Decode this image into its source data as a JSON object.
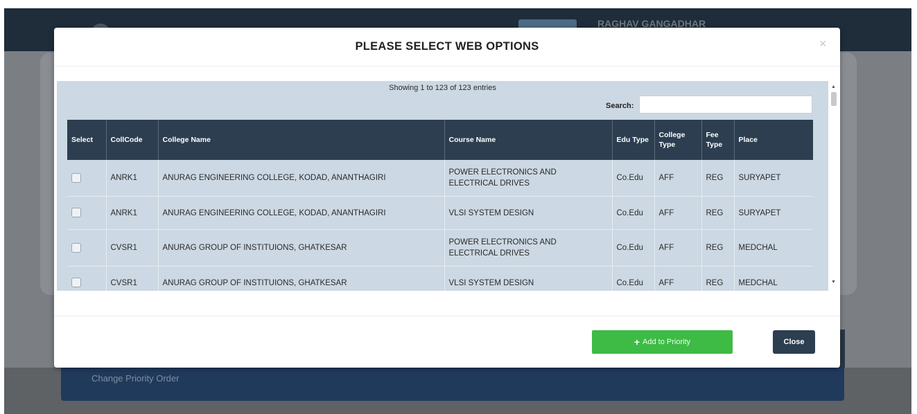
{
  "background": {
    "username": "RAGHAV GANGADHAR",
    "panel_label": "Change Priority Order"
  },
  "modal": {
    "title": "PLEASE SELECT WEB OPTIONS",
    "close_icon": "×",
    "info": "Showing 1 to 123 of 123 entries",
    "search_label": "Search:",
    "search_value": "",
    "columns": [
      "Select",
      "CollCode",
      "College Name",
      "Course Name",
      "Edu Type",
      "College Type",
      "Fee Type",
      "Place"
    ],
    "rows": [
      {
        "code": "ANRK1",
        "college": "ANURAG ENGINEERING COLLEGE, KODAD, ANANTHAGIRI",
        "course": "POWER ELECTRONICS AND ELECTRICAL DRIVES",
        "edu": "Co.Edu",
        "ctype": "AFF",
        "fee": "REG",
        "place": "SURYAPET",
        "checked": false
      },
      {
        "code": "ANRK1",
        "college": "ANURAG ENGINEERING COLLEGE, KODAD, ANANTHAGIRI",
        "course": "VLSI SYSTEM DESIGN",
        "edu": "Co.Edu",
        "ctype": "AFF",
        "fee": "REG",
        "place": "SURYAPET",
        "checked": false
      },
      {
        "code": "CVSR1",
        "college": "ANURAG GROUP OF INSTITUIONS, GHATKESAR",
        "course": "POWER ELECTRONICS AND ELECTRICAL DRIVES",
        "edu": "Co.Edu",
        "ctype": "AFF",
        "fee": "REG",
        "place": "MEDCHAL",
        "checked": false
      },
      {
        "code": "CVSR1",
        "college": "ANURAG GROUP OF INSTITUIONS, GHATKESAR",
        "course": "VLSI SYSTEM DESIGN",
        "edu": "Co.Edu",
        "ctype": "AFF",
        "fee": "REG",
        "place": "MEDCHAL",
        "checked": false
      }
    ],
    "add_button": "Add to Priority",
    "close_button": "Close"
  },
  "icons": {
    "add": "plus-icon",
    "close": "close-icon",
    "scroll_up": "scroll-up-arrow-icon",
    "scroll_down": "scroll-down-arrow-icon"
  },
  "colors": {
    "table_header": "#2c3e50",
    "table_body": "#ccd8e3",
    "add_button": "#3dbb45",
    "close_button": "#2c3e50"
  }
}
